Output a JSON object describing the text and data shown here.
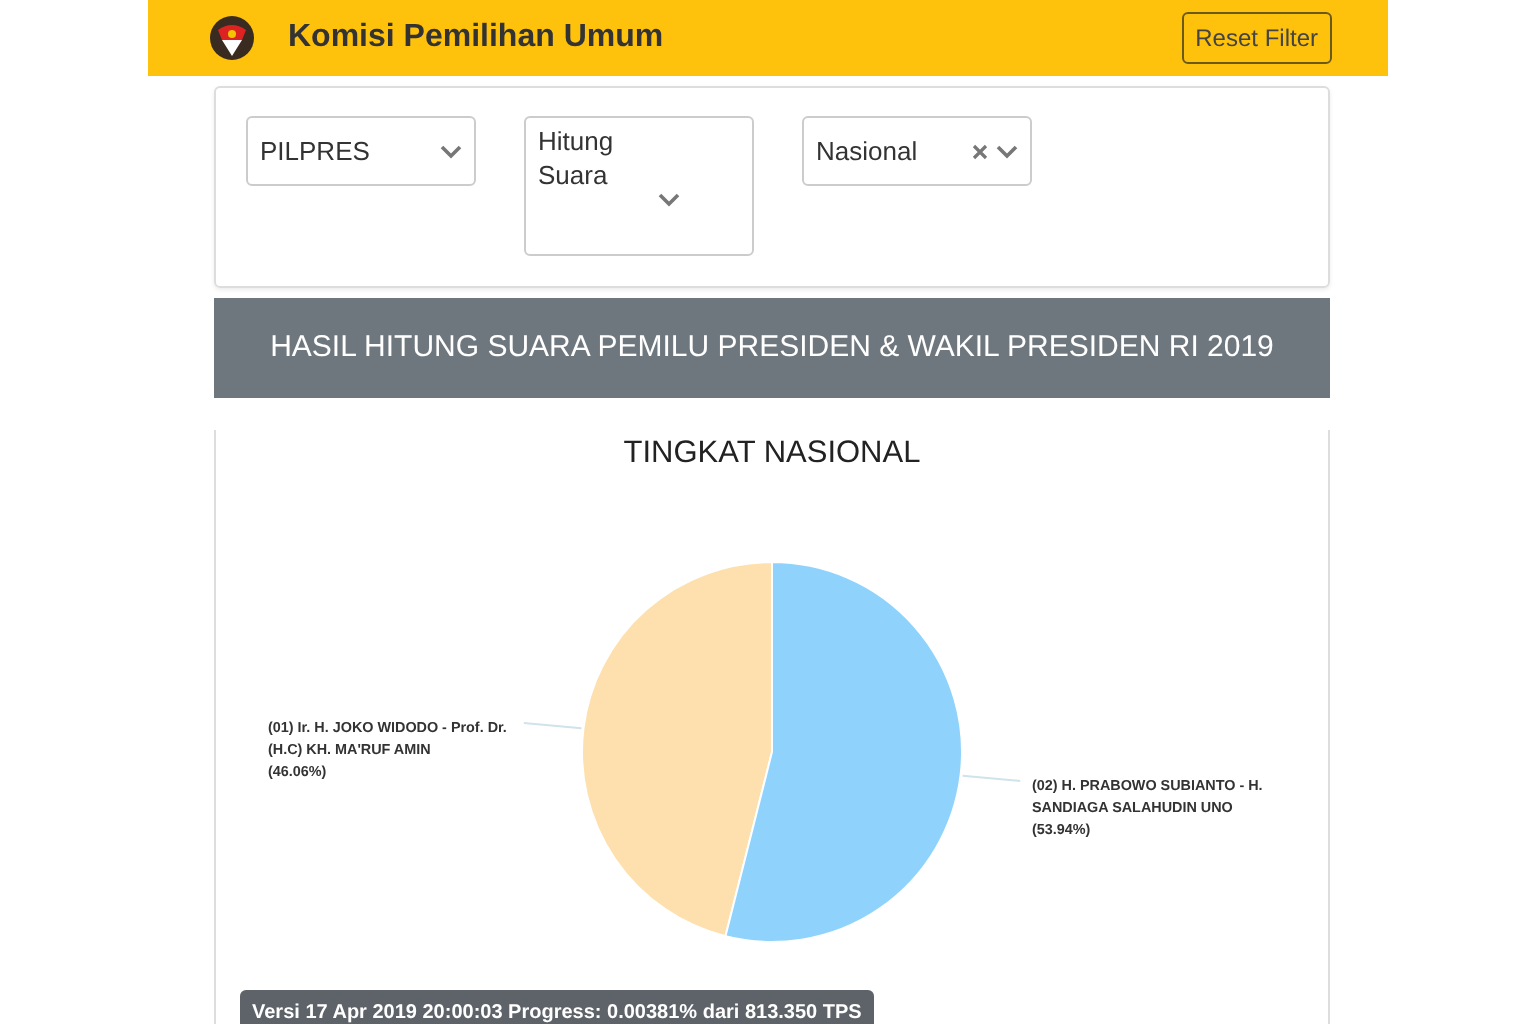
{
  "header": {
    "title": "Komisi Pemilihan Umum",
    "reset_button": "Reset Filter"
  },
  "filters": [
    {
      "kind": "single",
      "value": "PILPRES",
      "clearable": false
    },
    {
      "kind": "multi",
      "value": "Hitung Suara",
      "clearable": false
    },
    {
      "kind": "single",
      "value": "Nasional",
      "clearable": true
    }
  ],
  "banner": "HASIL HITUNG SUARA PEMILU PRESIDEN & WAKIL PRESIDEN RI 2019",
  "chart_data": {
    "type": "pie",
    "title": "TINGKAT NASIONAL",
    "categories": [
      "(01) Ir. H. JOKO WIDODO - Prof. Dr. (H.C) KH. MA'RUF AMIN",
      "(02) H. PRABOWO SUBIANTO - H. SANDIAGA SALAHUDIN UNO"
    ],
    "values": [
      46.06,
      53.94
    ],
    "value_labels": [
      "(46.06%)",
      "(53.94%)"
    ]
  },
  "version_badge": "Versi 17 Apr 2019 20:00:03 Progress: 0.00381% dari 813.350 TPS"
}
